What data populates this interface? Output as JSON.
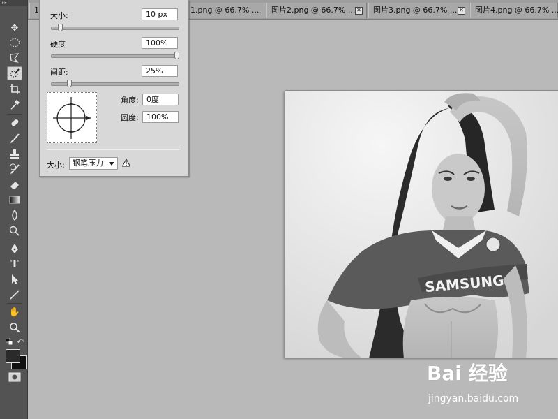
{
  "tabs": [
    {
      "label": "1",
      "closable": false
    },
    {
      "label": "1.png @ 66.7% ...",
      "closable": true
    },
    {
      "label": "图片2.png @ 66.7% ...",
      "closable": true
    },
    {
      "label": "图片3.png @ 66.7% ...",
      "closable": true
    },
    {
      "label": "图片4.png @ 66.7% ...",
      "closable": false
    }
  ],
  "brush_panel": {
    "size_label": "大小:",
    "size_value": "10 px",
    "size_level": 0.05,
    "hardness_label": "硬度",
    "hardness_value": "100%",
    "hardness_level": 1.0,
    "spacing_label": "间距:",
    "spacing_value": "25%",
    "spacing_level": 0.125,
    "angle_label": "角度:",
    "angle_value": "0度",
    "roundness_label": "圆度:",
    "roundness_value": "100%",
    "control_label": "大小:",
    "control_value": "钢笔压力"
  },
  "photo": {
    "jersey_text": "SAMSUNG"
  },
  "watermark": {
    "brand": "Bai 经验",
    "url": "jingyan.baidu.com"
  },
  "colors": {
    "toolbar_bg": "#535353",
    "canvas_bg": "#b9b9b9",
    "panel_bg": "#d8d8d8",
    "foreground_swatch": "#2a2a2a",
    "background_swatch": "#111111"
  },
  "tools": [
    "move-tool-icon",
    "marquee-tool-icon",
    "lasso-tool-icon",
    "quick-selection-tool-icon",
    "crop-tool-icon",
    "eyedropper-tool-icon",
    "healing-brush-tool-icon",
    "brush-tool-icon",
    "clone-stamp-tool-icon",
    "history-brush-tool-icon",
    "eraser-tool-icon",
    "gradient-tool-icon",
    "blur-tool-icon",
    "dodge-tool-icon",
    "pen-tool-icon",
    "type-tool-icon",
    "path-selection-tool-icon",
    "line-tool-icon",
    "hand-tool-icon",
    "zoom-tool-icon"
  ]
}
